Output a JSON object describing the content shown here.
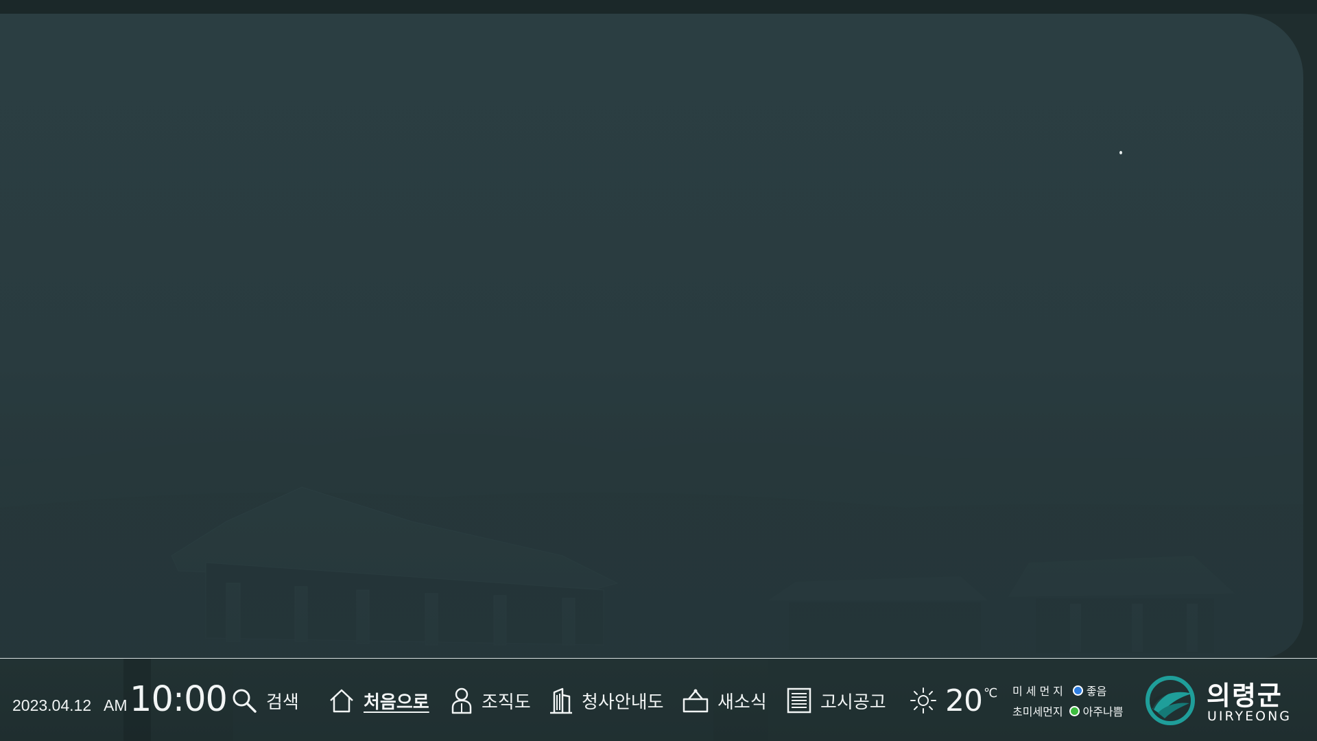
{
  "clock": {
    "date": "2023.04.12",
    "ampm": "AM",
    "time": "10:00"
  },
  "nav": {
    "search": {
      "label": "검색",
      "icon": "search-icon"
    },
    "home": {
      "label": "처음으로",
      "icon": "home-icon",
      "active": true
    },
    "org": {
      "label": "조직도",
      "icon": "people-icon"
    },
    "guide": {
      "label": "청사안내도",
      "icon": "building-icon"
    },
    "news": {
      "label": "새소식",
      "icon": "bag-icon"
    },
    "notice": {
      "label": "고시공고",
      "icon": "document-icon"
    }
  },
  "weather": {
    "icon": "sun-icon",
    "temperature": "20",
    "unit": "℃"
  },
  "air_quality": {
    "fine_dust_label": "미세먼지",
    "fine_dust_status": "좋음",
    "fine_dust_color": "#2f7ee0",
    "ultrafine_dust_label": "초미세먼지",
    "ultrafine_dust_status": "아주나쁨",
    "ultrafine_dust_color": "#3dbb3f"
  },
  "logo": {
    "name": "의령군",
    "roman": "UIRYEONG",
    "color_primary": "#1f9e9a",
    "color_secondary": "#157a77"
  },
  "colors": {
    "background": "#1f2d2e",
    "panel": "#2a3c40",
    "text": "#f2f5f5"
  }
}
